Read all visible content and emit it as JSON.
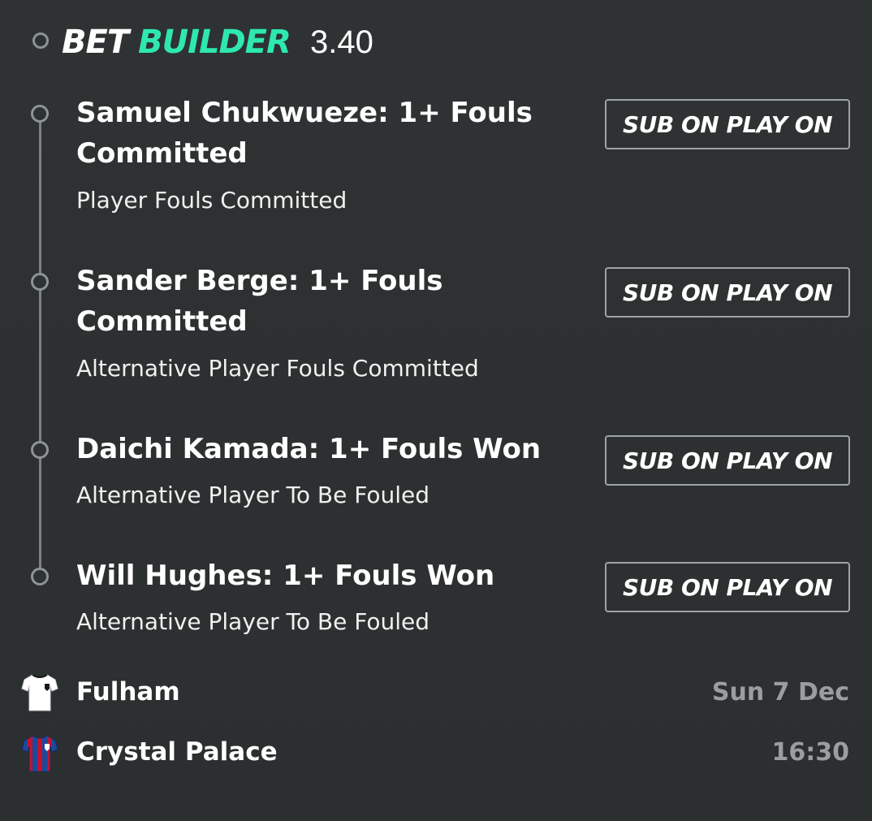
{
  "header": {
    "brand_part1": "BET",
    "brand_part2": "BUILDER",
    "odds": "3.40",
    "accent_color": "#2ee8b0"
  },
  "legs": [
    {
      "title": "Samuel Chukwueze: 1+ Fouls Committed",
      "market": "Player Fouls Committed",
      "button_label": "SUB ON PLAY ON"
    },
    {
      "title": "Sander Berge: 1+ Fouls Committed",
      "market": "Alternative Player Fouls Committed",
      "button_label": "SUB ON PLAY ON"
    },
    {
      "title": "Daichi Kamada: 1+ Fouls Won",
      "market": "Alternative Player To Be Fouled",
      "button_label": "SUB ON PLAY ON"
    },
    {
      "title": "Will Hughes: 1+ Fouls Won",
      "market": "Alternative Player To Be Fouled",
      "button_label": "SUB ON PLAY ON"
    }
  ],
  "match": {
    "home": {
      "name": "Fulham",
      "meta": "Sun 7 Dec",
      "shirt_icon": "fulham-shirt-icon",
      "shirt_color": "#ffffff"
    },
    "away": {
      "name": "Crystal Palace",
      "meta": "16:30",
      "shirt_icon": "crystal-palace-shirt-icon",
      "shirt_colors": [
        "#1b4a9c",
        "#c4122e"
      ]
    }
  }
}
